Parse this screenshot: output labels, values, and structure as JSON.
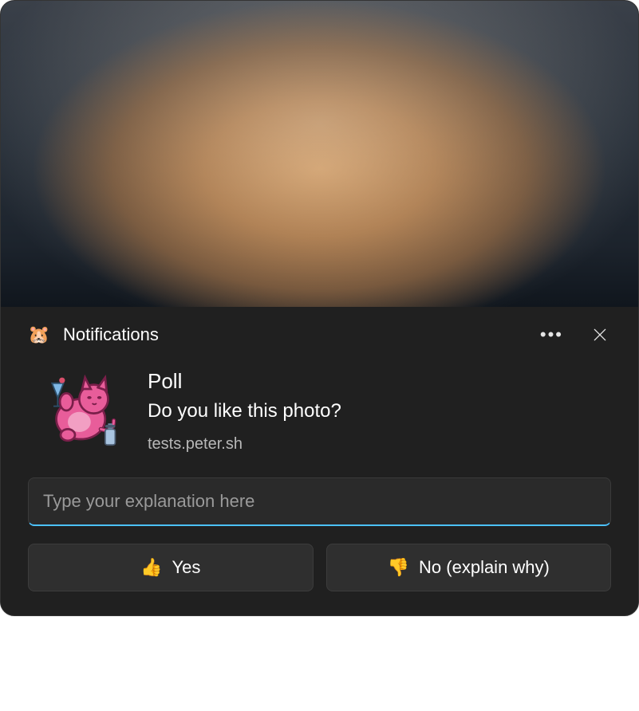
{
  "header": {
    "app_icon": "🐹",
    "title": "Notifications"
  },
  "poll": {
    "title": "Poll",
    "body": "Do you like this photo?",
    "source": "tests.peter.sh"
  },
  "input": {
    "placeholder": "Type your explanation here",
    "value": ""
  },
  "buttons": {
    "yes": {
      "emoji": "👍",
      "label": "Yes"
    },
    "no": {
      "emoji": "👎",
      "label": "No (explain why)"
    }
  }
}
